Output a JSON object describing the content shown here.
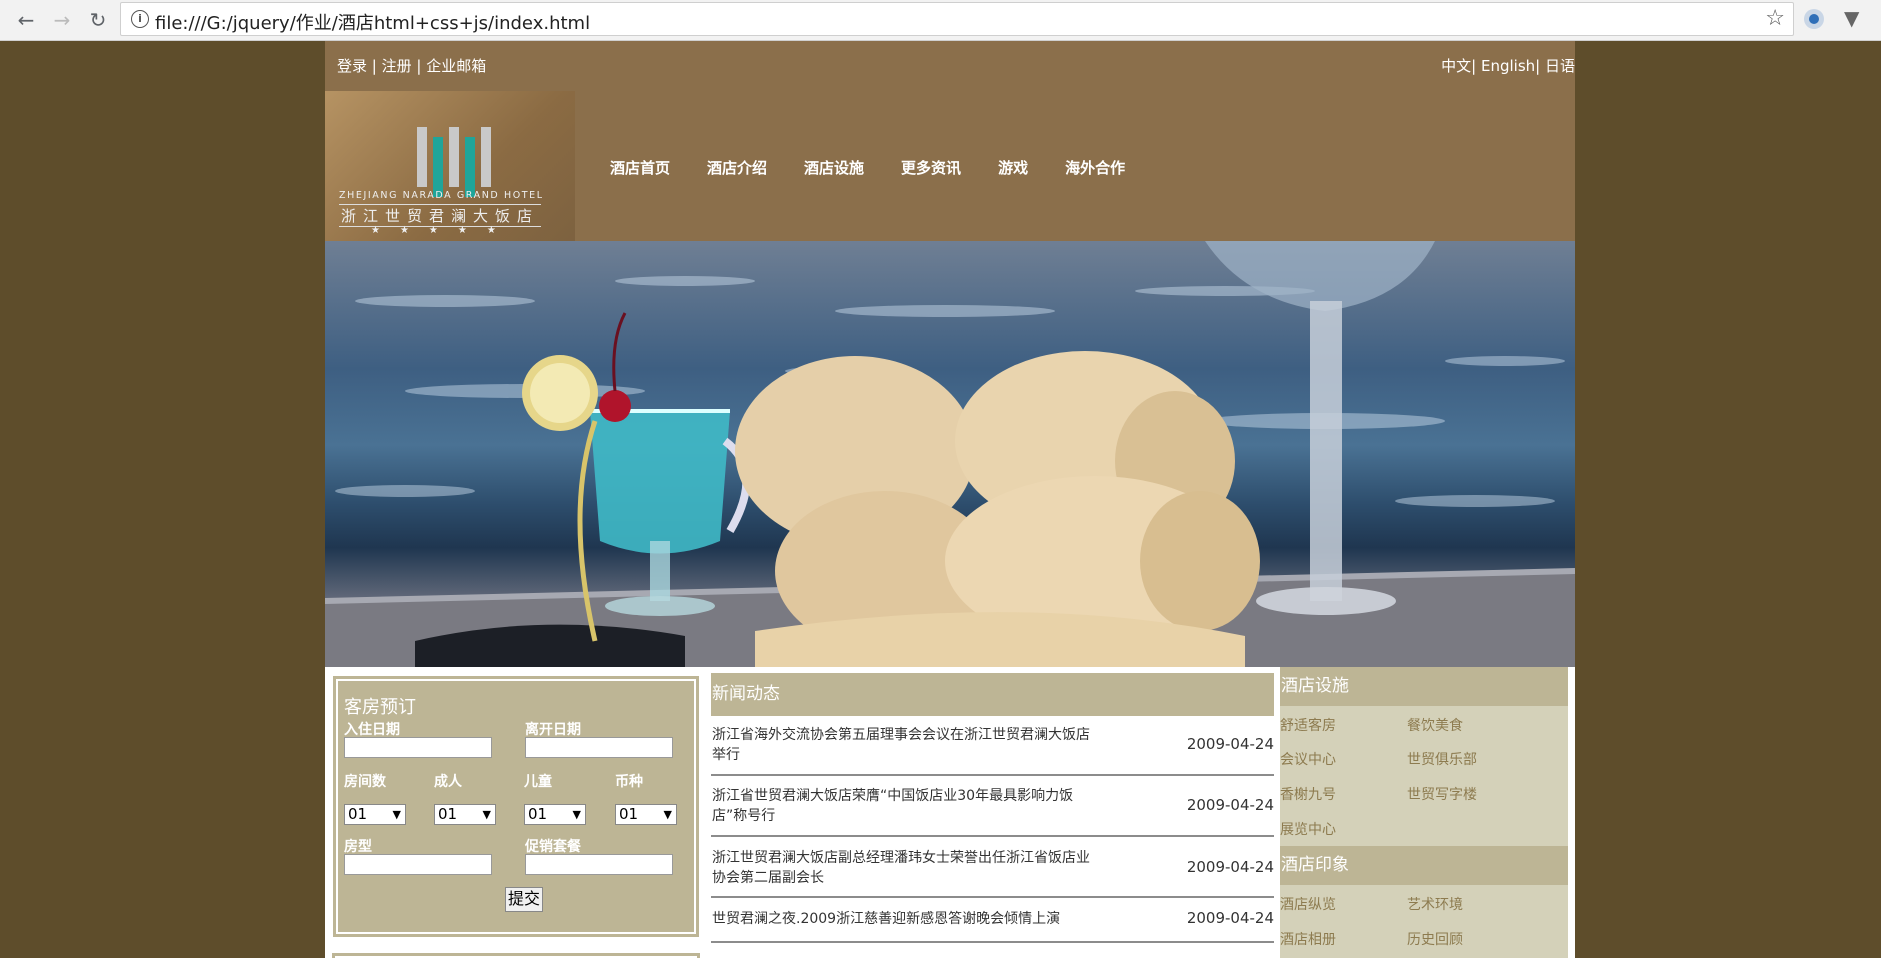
{
  "browser": {
    "url": "file:///G:/jquery/作业/酒店html+css+js/index.html"
  },
  "header": {
    "top_links": [
      "登录",
      "注册",
      "企业邮箱"
    ],
    "lang_links": [
      "中文",
      "English",
      "日语"
    ],
    "logo": {
      "en": "ZHEJIANG NARADA GRAND HOTEL",
      "cn": "浙江世贸君澜大饭店"
    },
    "nav": [
      "酒店首页",
      "酒店介绍",
      "酒店设施",
      "更多资讯",
      "游戏",
      "海外合作"
    ]
  },
  "booking": {
    "title": "客房预订",
    "checkin_label": "入住日期",
    "checkout_label": "离开日期",
    "rooms_label": "房间数",
    "adults_label": "成人",
    "children_label": "儿童",
    "currency_label": "币种",
    "rooms_value": "01",
    "adults_value": "01",
    "children_value": "01",
    "currency_value": "01",
    "room_type_label": "房型",
    "promo_label": "促销套餐",
    "submit_label": "提交"
  },
  "news": {
    "title": "新闻动态",
    "items": [
      {
        "text": "浙江省海外交流协会第五届理事会会议在浙江世贸君澜大饭店举行",
        "date": "2009-04-24"
      },
      {
        "text": "浙江省世贸君澜大饭店荣膺“中国饭店业30年最具影响力饭店”称号行",
        "date": "2009-04-24"
      },
      {
        "text": "浙江世贸君澜大饭店副总经理潘玮女士荣誉出任浙江省饭店业协会第二届副会长",
        "date": "2009-04-24"
      },
      {
        "text": "世贸君澜之夜.2009浙江慈善迎新感恩答谢晚会倾情上演",
        "date": "2009-04-24"
      }
    ]
  },
  "sidebar": {
    "facilities_title": "酒店设施",
    "facilities": [
      "舒适客房",
      "餐饮美食",
      "会议中心",
      "世贸俱乐部",
      "香榭九号",
      "世贸写字楼",
      "展览中心"
    ],
    "impression_title": "酒店印象",
    "impression": [
      "酒店纵览",
      "艺术环境",
      "酒店相册",
      "历史回顾"
    ]
  },
  "colors": {
    "page_bg": "#5e4d2b",
    "header_bg": "#8b6f4b",
    "panel_bg": "#bdb595",
    "sidebar_bg": "#d4d1b9",
    "link_color": "#8d7b4f"
  }
}
